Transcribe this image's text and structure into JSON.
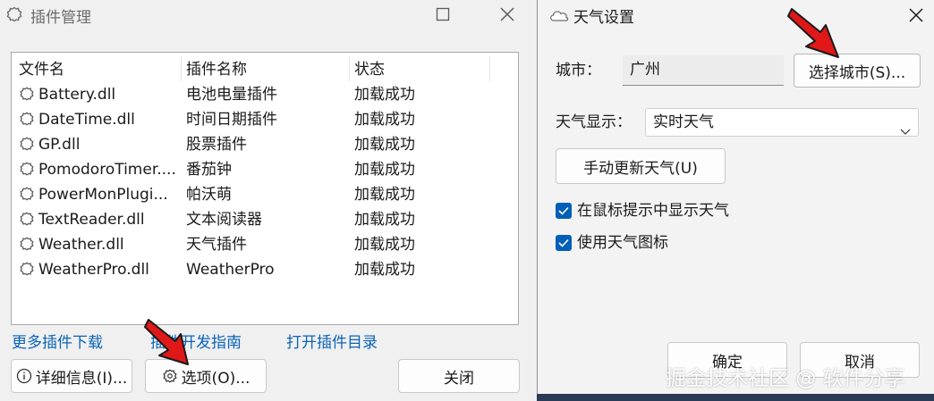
{
  "plugin_window": {
    "title": "插件管理",
    "columns": [
      "文件名",
      "插件名称",
      "状态"
    ],
    "rows": [
      {
        "file": "Battery.dll",
        "name": "电池电量插件",
        "status": "加载成功"
      },
      {
        "file": "DateTime.dll",
        "name": "时间日期插件",
        "status": "加载成功"
      },
      {
        "file": "GP.dll",
        "name": "股票插件",
        "status": "加载成功"
      },
      {
        "file": "PomodoroTimer....",
        "name": "番茄钟",
        "status": "加载成功"
      },
      {
        "file": "PowerMonPlugi...",
        "name": "帕沃萌",
        "status": "加载成功"
      },
      {
        "file": "TextReader.dll",
        "name": "文本阅读器",
        "status": "加载成功"
      },
      {
        "file": "Weather.dll",
        "name": "天气插件",
        "status": "加载成功"
      },
      {
        "file": "WeatherPro.dll",
        "name": "WeatherPro",
        "status": "加载成功"
      }
    ],
    "links": {
      "more_plugins": "更多插件下载",
      "dev_guide": "插件开发指南",
      "open_dir": "打开插件目录"
    },
    "buttons": {
      "details": "详细信息(I)...",
      "options": "选项(O)...",
      "close": "关闭"
    }
  },
  "weather_window": {
    "title": "天气设置",
    "city_label": "城市：",
    "city_value": "广州",
    "select_city_button": "选择城市(S)...",
    "display_label": "天气显示：",
    "display_value": "实时天气",
    "update_button": "手动更新天气(U)",
    "checkboxes": [
      {
        "label": "在鼠标提示中显示天气",
        "checked": true
      },
      {
        "label": "使用天气图标",
        "checked": true
      }
    ],
    "ok_button": "确定",
    "cancel_button": "取消"
  },
  "watermark": "掘金技术社区 @ 软件分享",
  "colors": {
    "accent": "#005fb8",
    "link": "#0a63b8",
    "annotation_arrow": "#e01818"
  }
}
